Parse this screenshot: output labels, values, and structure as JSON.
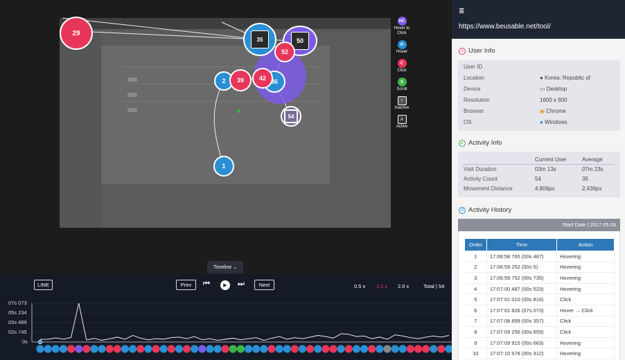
{
  "legend": [
    {
      "badge": "HC",
      "label": "Hover to Click",
      "color": "#7b5be6"
    },
    {
      "badge": "H",
      "label": "Hover",
      "color": "#2a8fd4"
    },
    {
      "badge": "C",
      "label": "Click",
      "color": "#e8365a"
    },
    {
      "badge": "S",
      "label": "Scroll",
      "color": "#3bb54a"
    },
    {
      "badge": "I",
      "label": "Inactive",
      "color": "#333333"
    },
    {
      "badge": "A",
      "label": "Active",
      "color": "#333333"
    }
  ],
  "bubbles": {
    "b29": "29",
    "b35": "35",
    "b50": "50",
    "b52": "52",
    "b2": "2",
    "b39": "39",
    "b42": "42",
    "b36": "36",
    "b54": "54",
    "b1": "1"
  },
  "timeline_tab": "Timeline",
  "controls": {
    "line": "LINE",
    "prev": "Prev",
    "next": "Next",
    "speed_05": "0.5 x",
    "speed_10": "1.0 x",
    "speed_20": "2.0 x",
    "total": "Total | 54"
  },
  "y_axis": [
    "07s 073",
    "05s 234",
    "03s 489",
    "02s 745",
    "0s"
  ],
  "chart_data": {
    "type": "line",
    "ylabel": "",
    "yticks": [
      "07s 073",
      "05s 234",
      "03s 489",
      "02s 745",
      "0s"
    ],
    "ylim": [
      0,
      7.073
    ],
    "x": [
      1,
      2,
      3,
      4,
      5,
      6,
      7,
      8,
      9,
      10,
      11,
      12,
      13,
      14,
      15,
      16,
      17,
      18,
      19,
      20,
      21,
      22,
      23,
      24,
      25,
      26,
      27,
      28,
      29,
      30,
      31,
      32,
      33,
      34,
      35,
      36,
      37,
      38,
      39,
      40,
      41,
      42,
      43,
      44,
      45,
      46,
      47,
      48,
      49,
      50,
      51,
      52,
      53,
      54
    ],
    "values": [
      0.49,
      0.5,
      0.74,
      0.52,
      0.82,
      7.07,
      0.36,
      0.66,
      0.31,
      0.58,
      0.9,
      0.5,
      1.2,
      0.7,
      0.4,
      0.6,
      0.5,
      0.8,
      0.9,
      0.6,
      1.0,
      0.4,
      0.6,
      0.3,
      0.5,
      0.7,
      0.4,
      0.6,
      0.8,
      0.3,
      0.7,
      1.0,
      0.5,
      0.8,
      0.6,
      0.9,
      1.2,
      1.0,
      0.7,
      1.5,
      1.4,
      1.0,
      1.1,
      0.6,
      0.9,
      0.5,
      1.3,
      1.1,
      0.8,
      0.6,
      0.9,
      1.1,
      0.9,
      1.2
    ],
    "markers": [
      "H",
      "H",
      "H",
      "H",
      "C",
      "HC",
      "C",
      "H",
      "H",
      "C",
      "C",
      "H",
      "H",
      "C",
      "H",
      "C",
      "H",
      "C",
      "H",
      "C",
      "H",
      "HC",
      "H",
      "H",
      "C",
      "S",
      "S",
      "H",
      "H",
      "H",
      "C",
      "H",
      "H",
      "C",
      "H",
      "C",
      "H",
      "C",
      "C",
      "H",
      "C",
      "H",
      "H",
      "C",
      "H",
      "I",
      "H",
      "H",
      "C",
      "C",
      "C",
      "H",
      "C",
      "H"
    ]
  },
  "right": {
    "url": "https://www.beusable.net/tool/",
    "user_info_title": "User Info",
    "user_info": [
      {
        "key": "User ID",
        "value": ""
      },
      {
        "key": "Location",
        "value": "Korea: Republic of"
      },
      {
        "key": "Device",
        "value": "Desktop"
      },
      {
        "key": "Resolution",
        "value": "1600 x 900"
      },
      {
        "key": "Browser",
        "value": "Chrome"
      },
      {
        "key": "OS",
        "value": "Windows"
      }
    ],
    "activity_info_title": "Activity Info",
    "activity_cols": [
      "Current User",
      "Average"
    ],
    "activity_rows": [
      {
        "key": "Visit Duration",
        "cur": "03m 13s",
        "avg": "07m 23s"
      },
      {
        "key": "Activity Count",
        "cur": "54",
        "avg": "35"
      },
      {
        "key": "Movement Distance",
        "cur": "4,806px",
        "avg": "2,436px"
      }
    ],
    "history_title": "Activity History",
    "start_date": "Start Date | 2017.05.08",
    "history_cols": [
      "Order",
      "Time",
      "Action"
    ],
    "history": [
      {
        "order": "1",
        "time": "17:06:58 765 (00s 487)",
        "action": "Hovering"
      },
      {
        "order": "2",
        "time": "17:06:59 252 (00s 5)",
        "action": "Hovering"
      },
      {
        "order": "3",
        "time": "17:06:59 752 (00s 735)",
        "action": "Hovering"
      },
      {
        "order": "4",
        "time": "17:07:00 487 (00s 523)",
        "action": "Hovering"
      },
      {
        "order": "5",
        "time": "17:07:01 010 (00s 816)",
        "action": "Click"
      },
      {
        "order": "6",
        "time": "17:07:01 826 (07s 073)",
        "action": "Hover → Click"
      },
      {
        "order": "7",
        "time": "17:07:08 899 (00s 357)",
        "action": "Click"
      },
      {
        "order": "8",
        "time": "17:07:09 256 (00s 659)",
        "action": "Click"
      },
      {
        "order": "9",
        "time": "17:07:09 915 (00s 663)",
        "action": "Hovering"
      },
      {
        "order": "10",
        "time": "17:07:10 578 (00s 312)",
        "action": "Hovering"
      }
    ]
  }
}
